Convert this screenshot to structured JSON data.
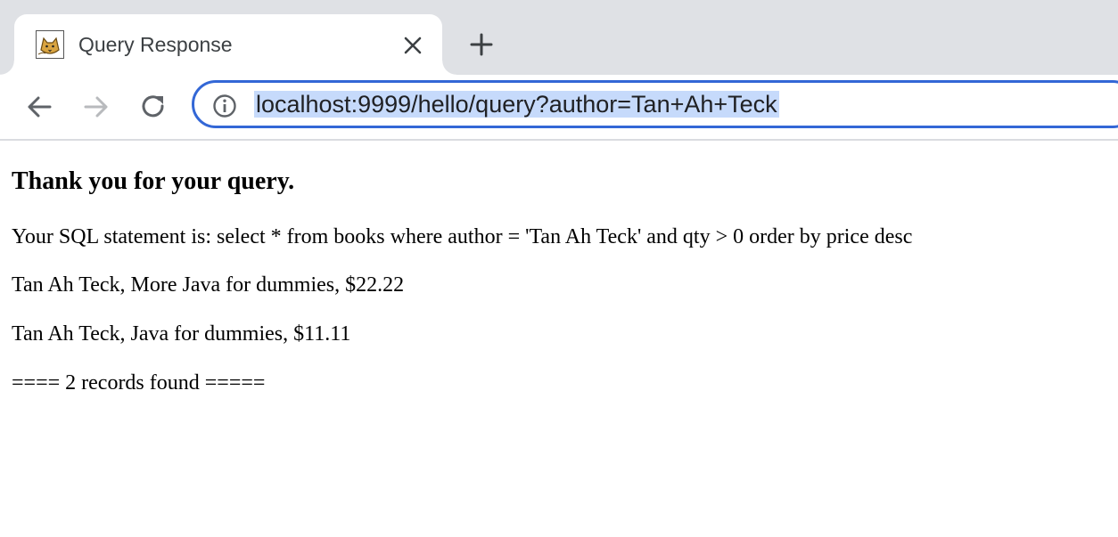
{
  "browser": {
    "tab": {
      "title": "Query Response",
      "favicon_icon": "tomcat-icon"
    },
    "toolbar": {
      "url": "localhost:9999/hello/query?author=Tan+Ah+Teck",
      "url_selected": true,
      "forward_enabled": false
    },
    "colors": {
      "omnibox_focus": "#3367d6",
      "selection": "#c6dafb",
      "tabstrip": "#dfe1e5"
    }
  },
  "page": {
    "heading": "Thank you for your query.",
    "sql_line": "Your SQL statement is: select * from books where author = 'Tan Ah Teck' and qty > 0 order by price desc",
    "records": [
      "Tan Ah Teck, More Java for dummies, $22.22",
      "Tan Ah Teck, Java for dummies, $11.11"
    ],
    "summary": "==== 2 records found ====="
  }
}
